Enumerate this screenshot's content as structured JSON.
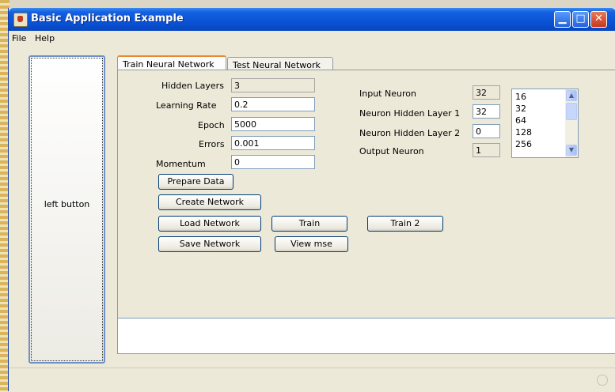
{
  "window": {
    "title": "Basic Application Example"
  },
  "menu": [
    "File",
    "Help"
  ],
  "left_button": "left button",
  "tabs": [
    {
      "label": "Train Neural Network",
      "active": true
    },
    {
      "label": "Test Neural Network",
      "active": false
    }
  ],
  "train": {
    "hidden_layers": {
      "label": "Hidden Layers",
      "value": "3"
    },
    "learning_rate": {
      "label": "Learning Rate",
      "value": "0.2"
    },
    "epoch": {
      "label": "Epoch",
      "value": "5000"
    },
    "errors": {
      "label": "Errors",
      "value": "0.001"
    },
    "momentum": {
      "label": "Momentum",
      "value": "0"
    },
    "input_neuron": {
      "label": "Input Neuron",
      "value": "32"
    },
    "hidden1": {
      "label": "Neuron Hidden Layer 1",
      "value": "32"
    },
    "hidden2": {
      "label": "Neuron Hidden Layer 2",
      "value": "0"
    },
    "output_neuron": {
      "label": "Output Neuron",
      "value": "1"
    },
    "neuron_options": [
      "16",
      "32",
      "64",
      "128",
      "256"
    ],
    "buttons": {
      "prepare": "Prepare Data",
      "create": "Create Network",
      "load": "Load Network",
      "train": "Train",
      "train2": "Train 2",
      "save": "Save Network",
      "view_mse": "View mse"
    }
  },
  "colors": {
    "title_bar": "#0a52d6",
    "active_tab_highlight": "#e68b2c"
  },
  "icons": [
    "app-icon",
    "minimize-icon",
    "maximize-icon",
    "close-icon",
    "scroll-up-icon",
    "scroll-down-icon"
  ]
}
